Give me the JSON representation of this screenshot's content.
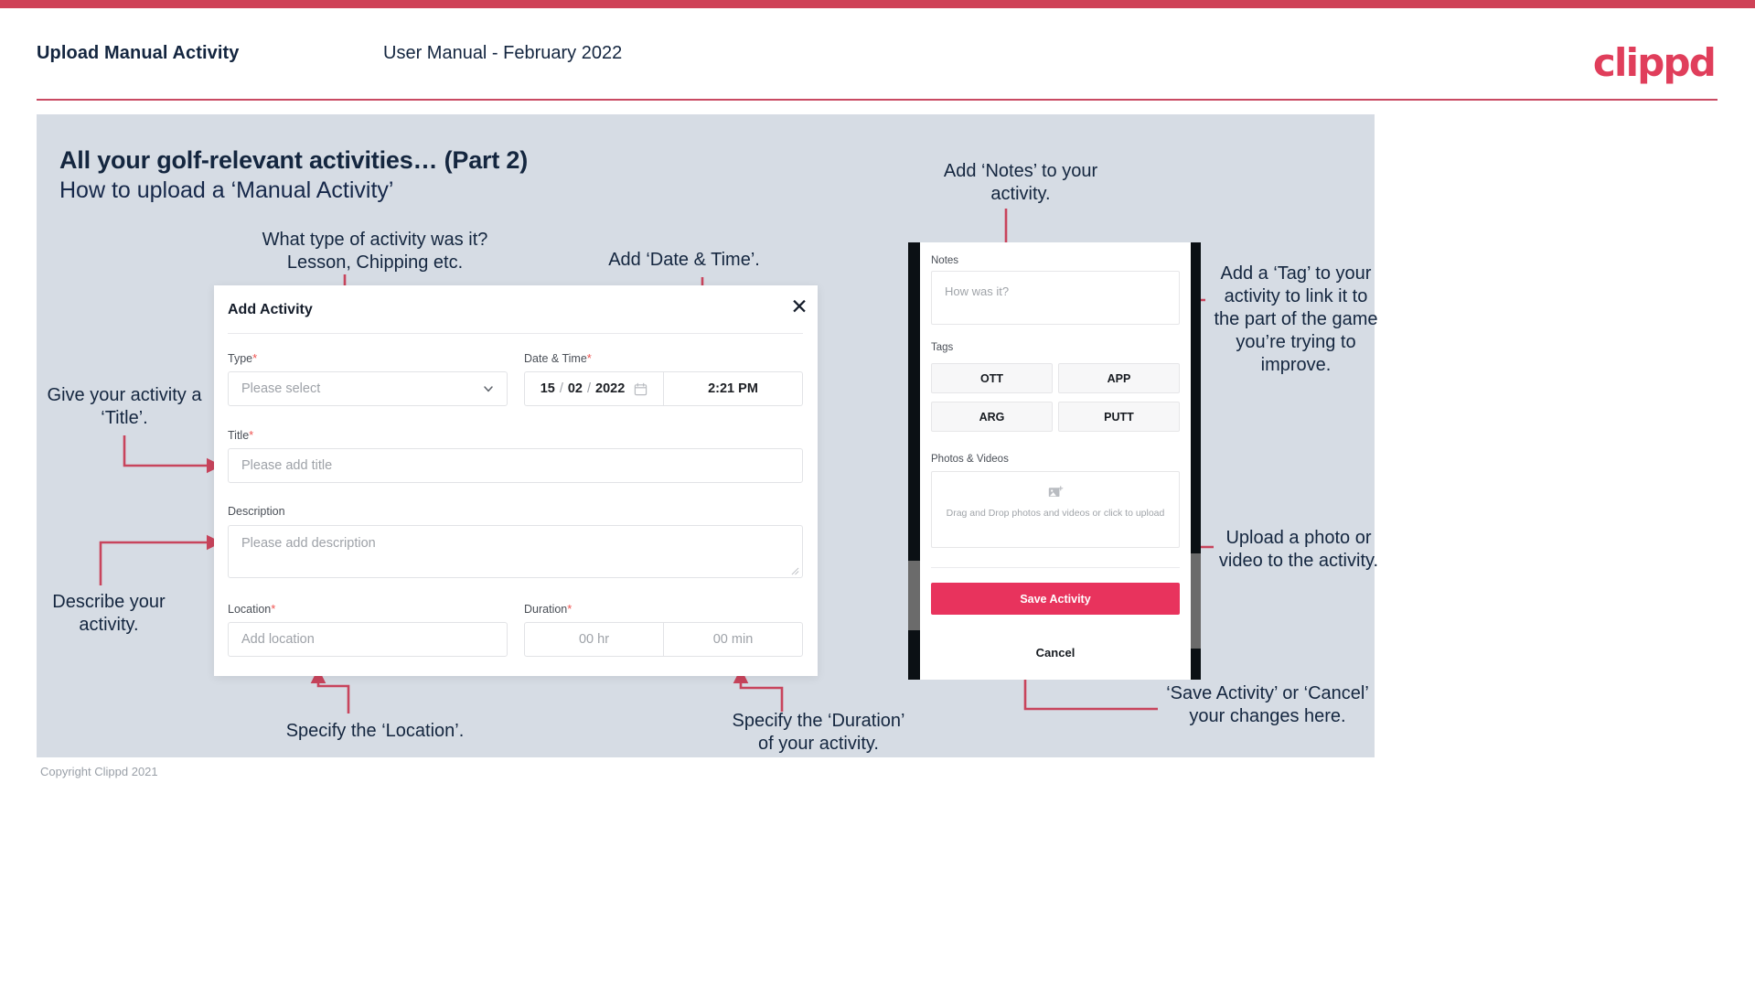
{
  "header": {
    "title": "Upload Manual Activity",
    "subtitle": "User Manual - February 2022",
    "brand": "clippd"
  },
  "headline": {
    "main": "All your golf-relevant activities… (Part 2)",
    "sub": "How to upload a ‘Manual Activity’"
  },
  "annotations": {
    "type": "What type of activity was it? Lesson, Chipping etc.",
    "datetime": "Add ‘Date & Time’.",
    "title": "Give your activity a ‘Title’.",
    "description": "Describe your activity.",
    "location": "Specify the ‘Location’.",
    "duration": "Specify the ‘Duration’ of your activity.",
    "notes": "Add ‘Notes’ to your activity.",
    "tag": "Add a ‘Tag’ to your activity to link it to the part of the game you’re trying to improve.",
    "upload": "Upload a photo or video to the activity.",
    "save": "‘Save Activity’ or ‘Cancel’ your changes here."
  },
  "modal": {
    "title": "Add Activity",
    "close_icon": "close-icon",
    "fields": {
      "type": {
        "label": "Type",
        "required": "*",
        "placeholder": "Please select",
        "chevron_icon": "chevron-down-icon"
      },
      "datetime": {
        "label": "Date & Time",
        "required": "*",
        "day": "15",
        "month": "02",
        "year": "2022",
        "separator": "/",
        "calendar_icon": "calendar-icon",
        "time": "2:21 PM"
      },
      "title": {
        "label": "Title",
        "required": "*",
        "placeholder": "Please add title"
      },
      "description": {
        "label": "Description",
        "required": "",
        "placeholder": "Please add description"
      },
      "location": {
        "label": "Location",
        "required": "*",
        "placeholder": "Add location"
      },
      "duration": {
        "label": "Duration",
        "required": "*",
        "hours_placeholder": "00 hr",
        "minutes_placeholder": "00 min"
      }
    }
  },
  "phone": {
    "notes": {
      "label": "Notes",
      "placeholder": "How was it?"
    },
    "tags": {
      "label": "Tags",
      "items": [
        "OTT",
        "APP",
        "ARG",
        "PUTT"
      ]
    },
    "photos": {
      "label": "Photos & Videos",
      "icon": "add-image-icon",
      "dropzone_text": "Drag and Drop photos and videos or click to upload"
    },
    "save_label": "Save Activity",
    "cancel_label": "Cancel"
  },
  "footer": {
    "copyright": "Copyright Clippd 2021"
  },
  "colors": {
    "brand_pink": "#e03e5b",
    "top_bar": "#cf4257",
    "panel_grey": "#d6dce4",
    "arrow_red": "#c8445c",
    "save_button": "#e8335d",
    "text_navy": "#14263f"
  }
}
